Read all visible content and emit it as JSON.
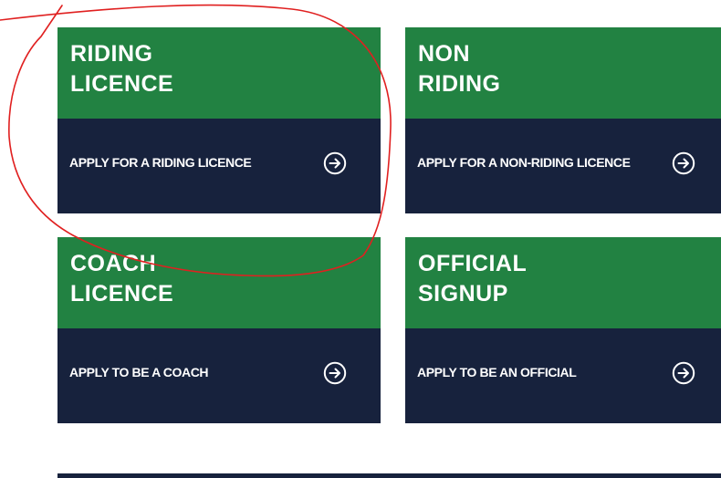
{
  "cards": [
    {
      "title_line1": "RIDING",
      "title_line2": "LICENCE",
      "link_label": "APPLY FOR A RIDING LICENCE",
      "icon": "arrow-right-circle-icon"
    },
    {
      "title_line1": "NON",
      "title_line2": "RIDING",
      "link_label": "APPLY FOR A NON-RIDING LICENCE",
      "icon": "arrow-right-circle-icon"
    },
    {
      "title_line1": "COACH",
      "title_line2": "LICENCE",
      "link_label": "APPLY TO BE A COACH",
      "icon": "arrow-right-circle-icon"
    },
    {
      "title_line1": "OFFICIAL",
      "title_line2": "SIGNUP",
      "link_label": "APPLY TO BE AN OFFICIAL",
      "icon": "arrow-right-circle-icon"
    }
  ],
  "colors": {
    "card_header": "#228242",
    "card_footer": "#17223d",
    "text": "#ffffff",
    "annotation": "#e02020"
  }
}
